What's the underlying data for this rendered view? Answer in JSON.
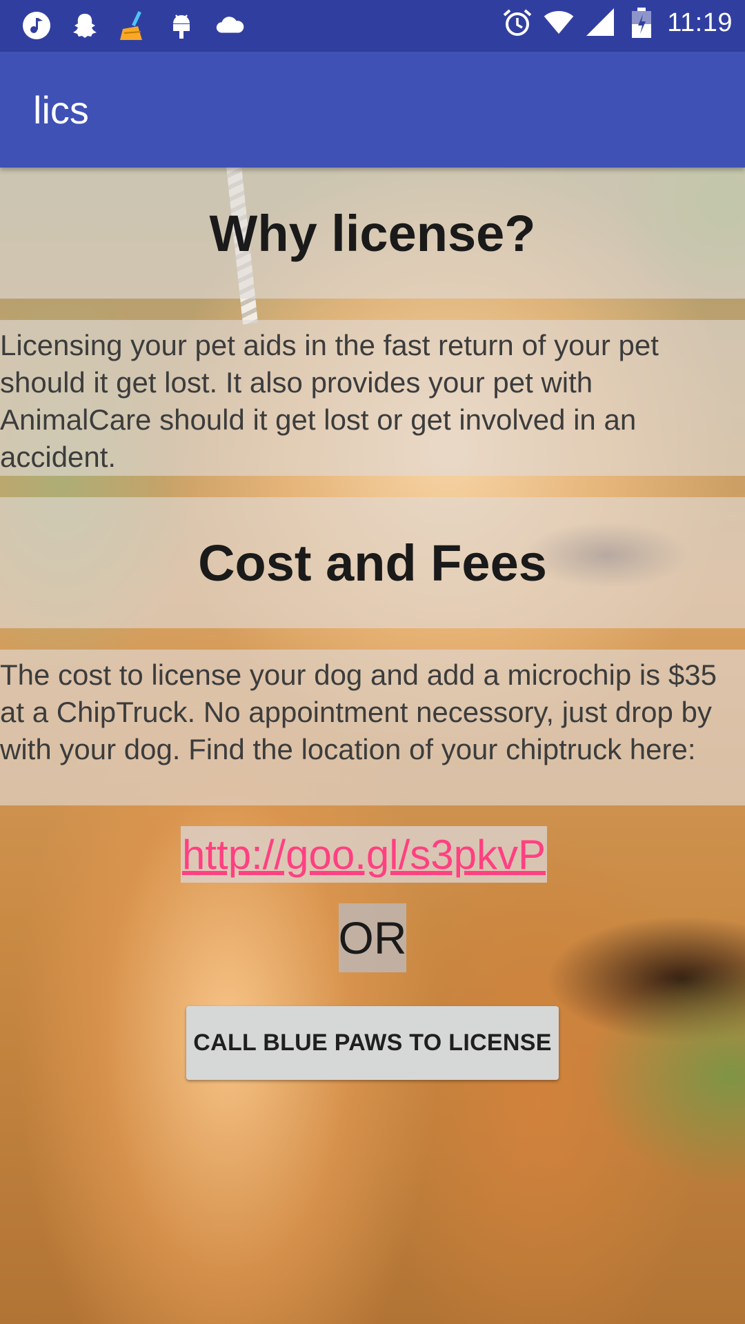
{
  "status_bar": {
    "time": "11:19",
    "left_icons": [
      "music-note-icon",
      "snapchat-ghost-icon",
      "broom-icon",
      "android-debug-icon",
      "cloud-icon"
    ],
    "right_icons": [
      "alarm-icon",
      "wifi-icon",
      "signal-icon",
      "battery-icon"
    ]
  },
  "app_bar": {
    "title": "lics",
    "color": "#3f51b5",
    "status_color": "#303f9f"
  },
  "sections": {
    "why": {
      "heading": "Why license?",
      "body": "Licensing your pet aids in the fast return of your pet should it get lost. It also provides your pet with AnimalCare should it get lost or get involved in an accident."
    },
    "cost": {
      "heading": "Cost and Fees",
      "body": "The cost to license your dog and add a microchip is $35 at a ChipTruck. No appointment necessory, just drop by with your dog. Find the location of your chiptruck here:"
    }
  },
  "link": {
    "text": "http://goo.gl/s3pkvP",
    "color": "#ff4081"
  },
  "or_label": "OR",
  "call_button": {
    "label": "CALL BLUE PAWS TO LICENSE"
  },
  "background": {
    "image": "golden-dog-photo"
  }
}
